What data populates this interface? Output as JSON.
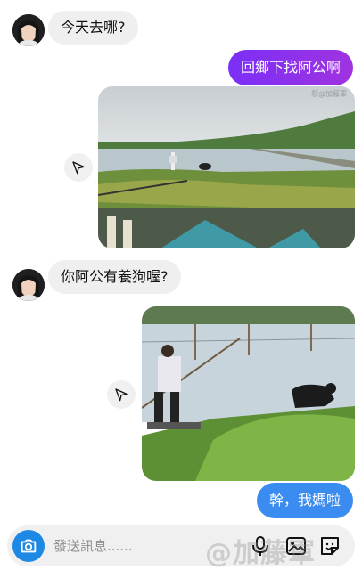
{
  "colors": {
    "outgoing_start": "#7b2ff7",
    "outgoing_end": "#a033e0",
    "outgoing_blue": "#3b8cf0",
    "camera": "#1e88e5"
  },
  "messages": [
    {
      "sender": "them",
      "text": "今天去哪?"
    },
    {
      "sender": "me",
      "text": "回鄉下找阿公啊"
    },
    {
      "sender": "me",
      "type": "photo",
      "watermark": "裂@加藤軍"
    },
    {
      "sender": "them",
      "text": "你阿公有養狗喔?"
    },
    {
      "sender": "me",
      "type": "photo"
    },
    {
      "sender": "me",
      "text": "幹，我媽啦"
    }
  ],
  "composer": {
    "placeholder": "發送訊息......"
  },
  "watermark": "@加藤軍",
  "icons": [
    "avatar",
    "share-icon",
    "camera-icon",
    "mic-icon",
    "gallery-icon",
    "sticker-icon"
  ]
}
